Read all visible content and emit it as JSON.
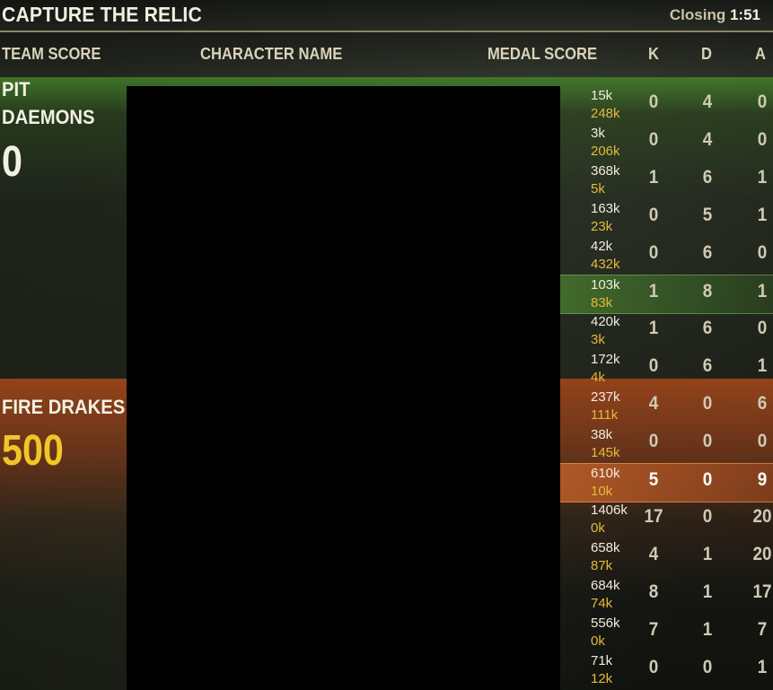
{
  "header": {
    "title": "CAPTURE THE RELIC",
    "closing_label": "Closing",
    "closing_time": "1:51"
  },
  "columns": {
    "team_score": "TEAM SCORE",
    "character_name": "CHARACTER NAME",
    "medal_score": "MEDAL SCORE",
    "k": "K",
    "d": "D",
    "a": "A"
  },
  "teams": [
    {
      "name_line1": "PIT",
      "name_line2": "DAEMONS",
      "score": "0",
      "color": "#4a8c2a"
    },
    {
      "name_line1": "FIRE DRAKES",
      "score": "500",
      "score_color": "#f2c628",
      "color": "#a8502a"
    }
  ],
  "rows": [
    {
      "medal": "15k",
      "sub": "248k",
      "k": "0",
      "d": "4",
      "a": "0"
    },
    {
      "medal": "3k",
      "sub": "206k",
      "k": "0",
      "d": "4",
      "a": "0"
    },
    {
      "medal": "368k",
      "sub": "5k",
      "k": "1",
      "d": "6",
      "a": "1"
    },
    {
      "medal": "163k",
      "sub": "23k",
      "k": "0",
      "d": "5",
      "a": "1"
    },
    {
      "medal": "42k",
      "sub": "432k",
      "k": "0",
      "d": "6",
      "a": "0"
    },
    {
      "medal": "103k",
      "sub": "83k",
      "k": "1",
      "d": "8",
      "a": "1"
    },
    {
      "medal": "420k",
      "sub": "3k",
      "k": "1",
      "d": "6",
      "a": "0"
    },
    {
      "medal": "172k",
      "sub": "4k",
      "k": "0",
      "d": "6",
      "a": "1"
    },
    {
      "medal": "237k",
      "sub": "111k",
      "k": "4",
      "d": "0",
      "a": "6"
    },
    {
      "medal": "38k",
      "sub": "145k",
      "k": "0",
      "d": "0",
      "a": "0"
    },
    {
      "medal": "610k",
      "sub": "10k",
      "k": "5",
      "d": "0",
      "a": "9"
    },
    {
      "medal": "1406k",
      "sub": "0k",
      "k": "17",
      "d": "0",
      "a": "20"
    },
    {
      "medal": "658k",
      "sub": "87k",
      "k": "4",
      "d": "1",
      "a": "20"
    },
    {
      "medal": "684k",
      "sub": "74k",
      "k": "8",
      "d": "1",
      "a": "17"
    },
    {
      "medal": "556k",
      "sub": "0k",
      "k": "7",
      "d": "1",
      "a": "7"
    },
    {
      "medal": "71k",
      "sub": "12k",
      "k": "0",
      "d": "0",
      "a": "1"
    }
  ]
}
